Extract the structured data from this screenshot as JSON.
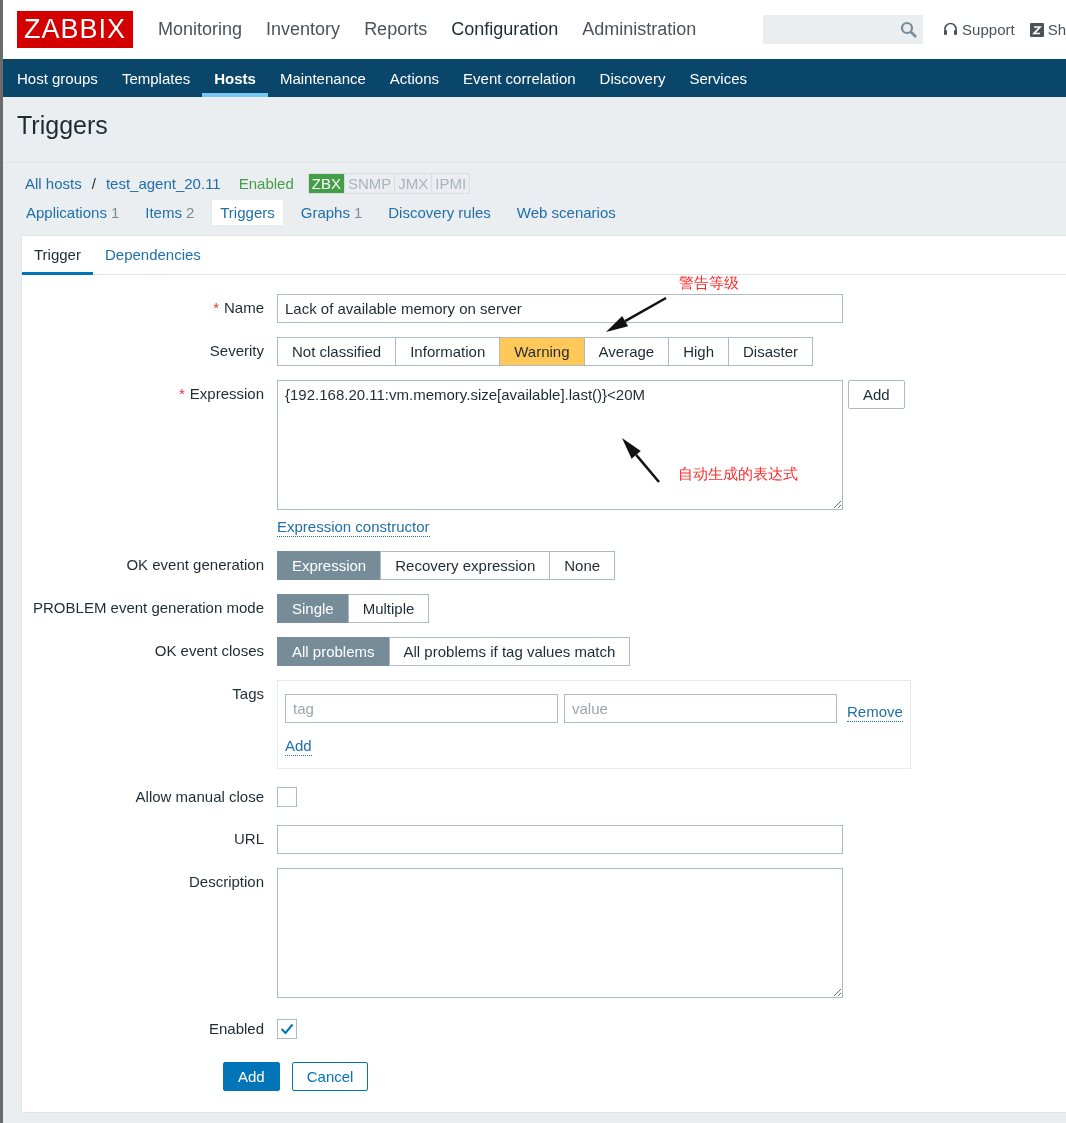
{
  "header": {
    "logo": "ZABBIX",
    "menu": [
      {
        "label": "Monitoring",
        "selected": false
      },
      {
        "label": "Inventory",
        "selected": false
      },
      {
        "label": "Reports",
        "selected": false
      },
      {
        "label": "Configuration",
        "selected": true
      },
      {
        "label": "Administration",
        "selected": false
      }
    ],
    "links": [
      {
        "label": "Support",
        "kind": "support"
      },
      {
        "label": "Sh",
        "kind": "share"
      }
    ]
  },
  "submenu": [
    {
      "label": "Host groups",
      "selected": false
    },
    {
      "label": "Templates",
      "selected": false
    },
    {
      "label": "Hosts",
      "selected": true
    },
    {
      "label": "Maintenance",
      "selected": false
    },
    {
      "label": "Actions",
      "selected": false
    },
    {
      "label": "Event correlation",
      "selected": false
    },
    {
      "label": "Discovery",
      "selected": false
    },
    {
      "label": "Services",
      "selected": false
    }
  ],
  "page_title": "Triggers",
  "breadcrumb": {
    "items": [
      "All hosts",
      "test_agent_20.11"
    ],
    "separator": "/"
  },
  "host_status": "Enabled",
  "availability": [
    {
      "label": "ZBX",
      "on": true
    },
    {
      "label": "SNMP",
      "on": false
    },
    {
      "label": "JMX",
      "on": false
    },
    {
      "label": "IPMI",
      "on": false
    }
  ],
  "host_tabs": [
    {
      "label": "Applications",
      "count": "1",
      "selected": false
    },
    {
      "label": "Items",
      "count": "2",
      "selected": false
    },
    {
      "label": "Triggers",
      "selected": true
    },
    {
      "label": "Graphs",
      "count": "1",
      "selected": false
    },
    {
      "label": "Discovery rules",
      "selected": false
    },
    {
      "label": "Web scenarios",
      "selected": false
    }
  ],
  "form_tabs": [
    {
      "label": "Trigger",
      "selected": true
    },
    {
      "label": "Dependencies",
      "selected": false
    }
  ],
  "fields": [
    {
      "kind": "text",
      "label": "Name",
      "marker": "*",
      "value": "Lack of available memory on server"
    },
    {
      "kind": "severity",
      "label": "Severity",
      "options": [
        {
          "label": "Not classified",
          "selected": false
        },
        {
          "label": "Information",
          "selected": false
        },
        {
          "label": "Warning",
          "selected": true
        },
        {
          "label": "Average",
          "selected": false
        },
        {
          "label": "High",
          "selected": false
        },
        {
          "label": "Disaster",
          "selected": false
        }
      ]
    },
    {
      "kind": "expression",
      "label": "Expression",
      "marker": "*",
      "value": "{192.168.20.11:vm.memory.size[available].last()}<20M",
      "button": "Add",
      "link": "Expression constructor"
    },
    {
      "kind": "toggle",
      "label": "OK event generation",
      "options": [
        {
          "label": "Expression",
          "selected": true
        },
        {
          "label": "Recovery expression",
          "selected": false
        },
        {
          "label": "None",
          "selected": false
        }
      ]
    },
    {
      "kind": "toggle",
      "label": "PROBLEM event generation mode",
      "options": [
        {
          "label": "Single",
          "selected": true
        },
        {
          "label": "Multiple",
          "selected": false
        }
      ]
    },
    {
      "kind": "toggle",
      "label": "OK event closes",
      "options": [
        {
          "label": "All problems",
          "selected": true
        },
        {
          "label": "All problems if tag values match",
          "selected": false
        }
      ]
    },
    {
      "kind": "tags",
      "label": "Tags",
      "tag_placeholder": "tag",
      "value_placeholder": "value",
      "remove": "Remove",
      "add": "Add"
    },
    {
      "kind": "checkbox",
      "label": "Allow manual close",
      "checked": false
    },
    {
      "kind": "text",
      "label": "URL"
    },
    {
      "kind": "textarea",
      "label": "Description"
    },
    {
      "kind": "checkbox",
      "label": "Enabled",
      "checked": true
    }
  ],
  "buttons": [
    {
      "label": "Add",
      "kind": "primary"
    },
    {
      "label": "Cancel",
      "kind": "secondary"
    }
  ],
  "annotations": [
    {
      "text": "警告等级",
      "kind": "severity"
    },
    {
      "text": "自动生成的表达式",
      "kind": "expression"
    }
  ]
}
